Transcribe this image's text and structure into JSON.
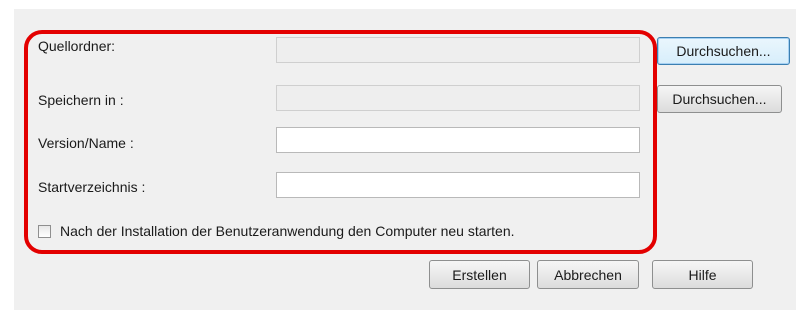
{
  "form": {
    "source_folder_label": "Quellordner:",
    "save_in_label": "Speichern in :",
    "version_label": "Version/Name :",
    "start_dir_label": "Startverzeichnis :",
    "source_folder_value": "",
    "save_in_value": "",
    "version_value": "",
    "start_dir_value": "",
    "browse_label": "Durchsuchen...",
    "restart_checkbox_label": "Nach der Installation der Benutzeranwendung den Computer neu starten.",
    "restart_checked": false
  },
  "buttons": {
    "create": "Erstellen",
    "cancel": "Abbrechen",
    "help": "Hilfe"
  },
  "annotation": {
    "highlight_color": "#e30000"
  }
}
